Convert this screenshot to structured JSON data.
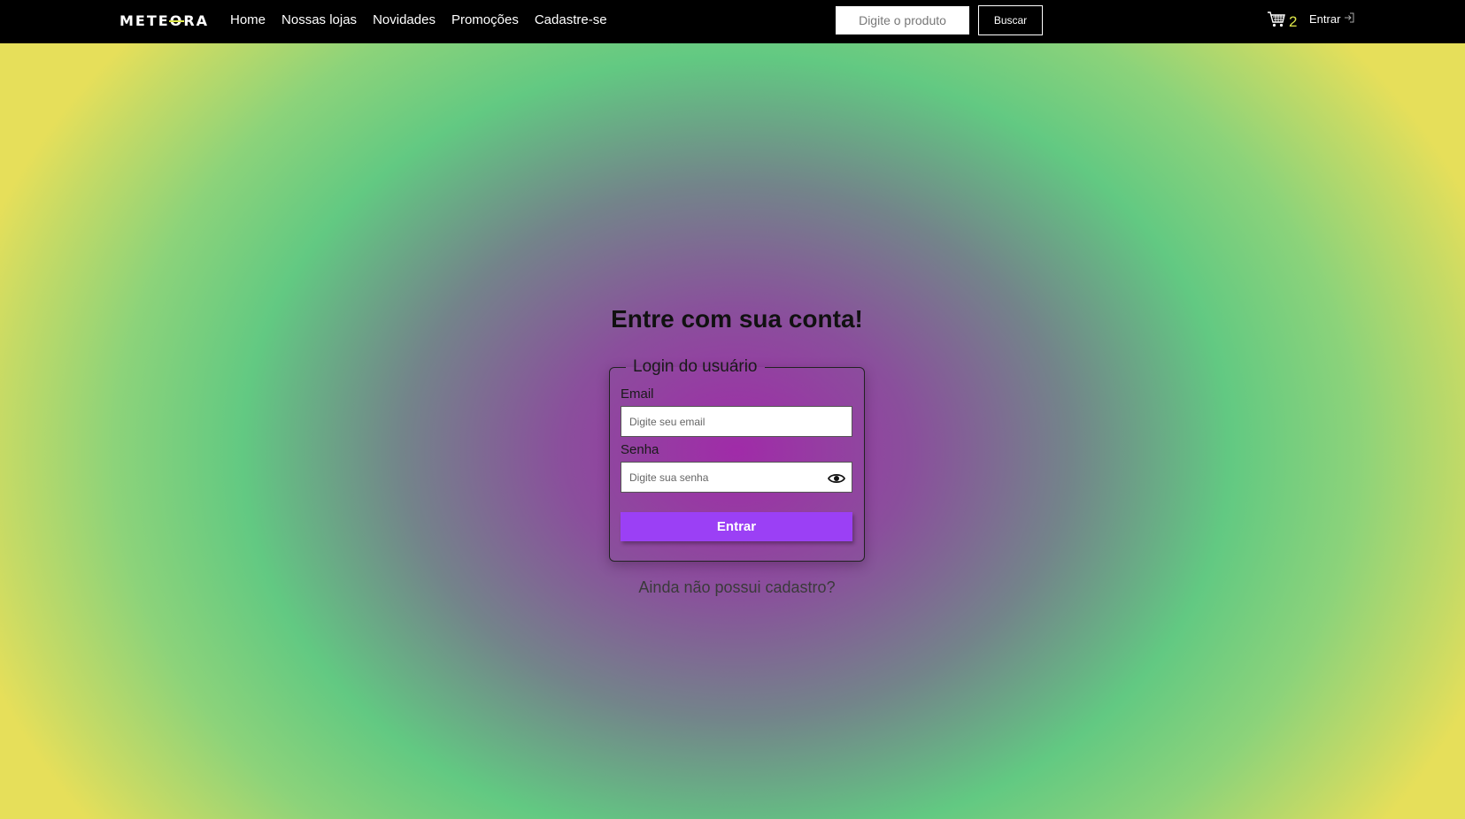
{
  "header": {
    "logo_text": "METEORA",
    "nav": [
      "Home",
      "Nossas lojas",
      "Novidades",
      "Promoções",
      "Cadastre-se"
    ],
    "search_placeholder": "Digite o produto",
    "search_button": "Buscar",
    "cart_icon": "cart-icon",
    "cart_count": "2",
    "login_label": "Entrar",
    "login_icon": "login-arrow-icon"
  },
  "main": {
    "title": "Entre com sua conta!",
    "form": {
      "legend": "Login do usuário",
      "email_label": "Email",
      "email_placeholder": "Digite seu email",
      "password_label": "Senha",
      "password_placeholder": "Digite sua senha",
      "password_toggle_icon": "eye-icon",
      "submit_label": "Entrar"
    },
    "signup_link": "Ainda não possui cadastro?"
  },
  "colors": {
    "accent": "#9b40f5",
    "logo_accent": "#dfe84a",
    "header_bg": "#000000"
  }
}
